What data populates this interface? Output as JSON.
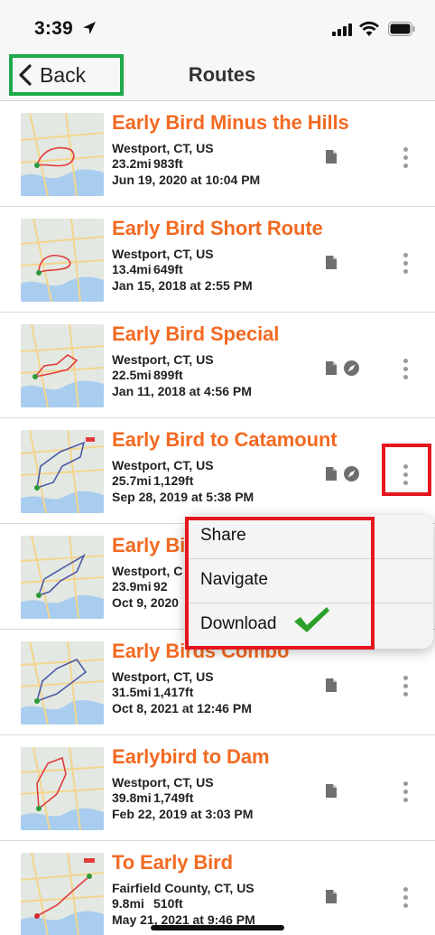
{
  "status_bar": {
    "time": "3:39"
  },
  "nav": {
    "back_label": "Back",
    "title": "Routes"
  },
  "routes": [
    {
      "title": "Early Bird Minus the Hills",
      "location": "Westport, CT, US",
      "distance": "23.2mi",
      "elevation": "983ft",
      "date": "Jun 19, 2020 at 10:04 PM",
      "icons": [
        "document-icon"
      ]
    },
    {
      "title": "Early Bird Short Route",
      "location": "Westport, CT, US",
      "distance": "13.4mi",
      "elevation": "649ft",
      "date": "Jan 15, 2018 at 2:55 PM",
      "icons": [
        "document-icon"
      ]
    },
    {
      "title": "Early Bird Special",
      "location": "Westport, CT, US",
      "distance": "22.5mi",
      "elevation": "899ft",
      "date": "Jan 11, 2018 at 4:56 PM",
      "icons": [
        "document-icon",
        "compass-icon"
      ]
    },
    {
      "title": "Early Bird to Catamount",
      "location": "Westport, CT, US",
      "distance": "25.7mi",
      "elevation": "1,129ft",
      "date": "Sep 28, 2019 at 5:38 PM",
      "icons": [
        "document-icon",
        "compass-icon"
      ]
    },
    {
      "title": "Early Bi",
      "location": "Westport, C",
      "distance": "23.9mi",
      "elevation": "92",
      "date": "Oct 9, 2020",
      "icons": []
    },
    {
      "title": "Early Birds Combo",
      "location": "Westport, CT, US",
      "distance": "31.5mi",
      "elevation": "1,417ft",
      "date": "Oct 8, 2021 at 12:46 PM",
      "icons": [
        "document-icon"
      ]
    },
    {
      "title": "Earlybird to Dam",
      "location": "Westport, CT, US",
      "distance": "39.8mi",
      "elevation": "1,749ft",
      "date": "Feb 22, 2019 at 3:03 PM",
      "icons": [
        "document-icon"
      ]
    },
    {
      "title": "To Early Bird",
      "location": "Fairfield County, CT, US",
      "distance": "9.8mi",
      "elevation": "510ft",
      "date": "May 21, 2021 at 9:46 PM",
      "icons": [
        "document-icon"
      ]
    }
  ],
  "context_menu": {
    "items": [
      "Share",
      "Navigate",
      "Download"
    ],
    "confirmed_icon": "checkmark-icon"
  },
  "colors": {
    "accent": "#f26a22",
    "back_highlight": "#1faa4a",
    "annotation_red": "#e5161d",
    "check_green": "#2aa02a"
  }
}
